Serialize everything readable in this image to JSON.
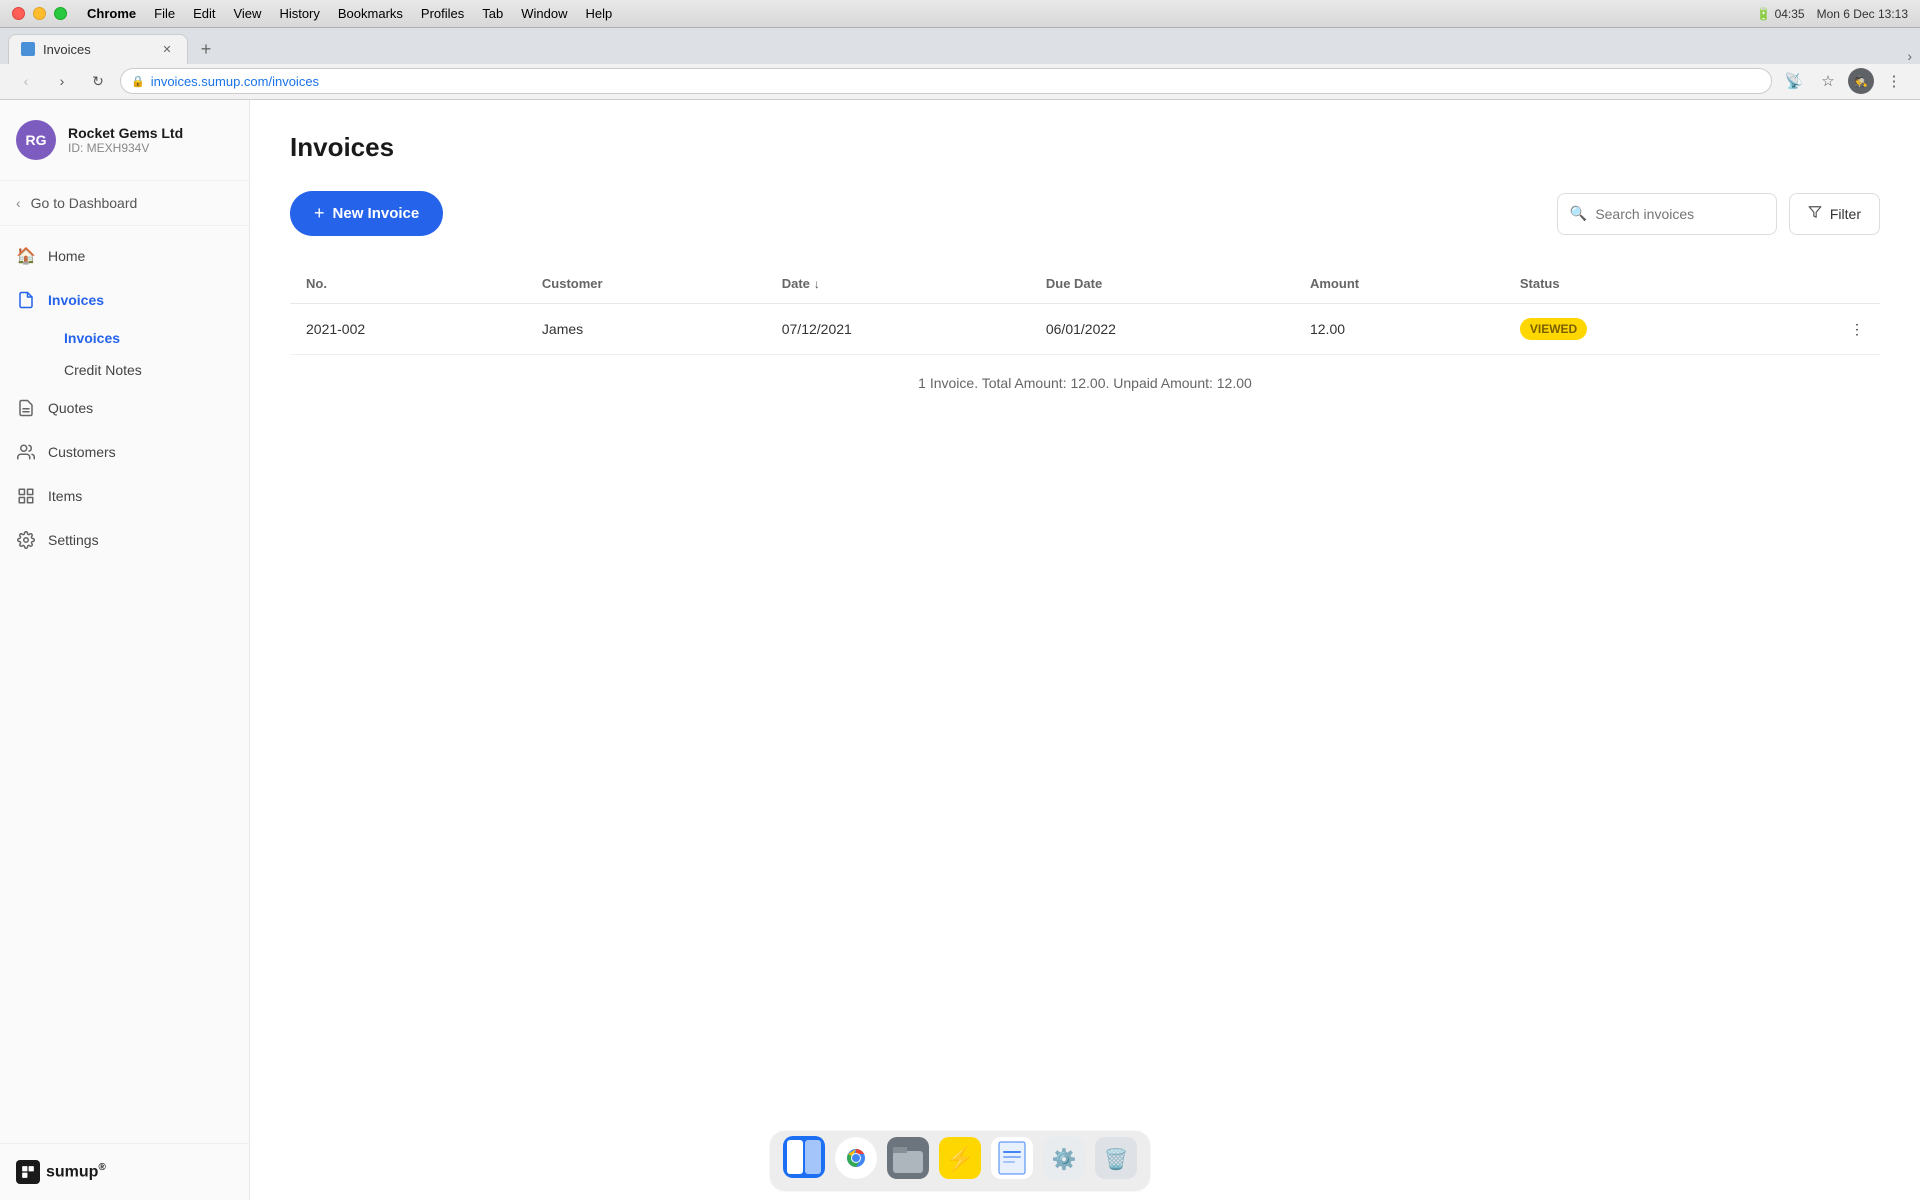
{
  "os": {
    "menu_items": [
      "Chrome",
      "File",
      "Edit",
      "View",
      "History",
      "Bookmarks",
      "Profiles",
      "Tab",
      "Window",
      "Help"
    ],
    "time": "Mon 6 Dec  13:13",
    "battery_time": "04:35"
  },
  "browser": {
    "tab_title": "Invoices",
    "tab_favicon_label": "I",
    "url": "invoices.sumup.com/invoices",
    "profile_label": "Incognito"
  },
  "sidebar": {
    "profile": {
      "initials": "RG",
      "name": "Rocket Gems Ltd",
      "id": "ID: MEXH934V"
    },
    "go_dashboard": "Go to Dashboard",
    "nav_items": [
      {
        "id": "home",
        "label": "Home",
        "icon": "🏠"
      },
      {
        "id": "invoices",
        "label": "Invoices",
        "icon": "📄",
        "active": true,
        "has_sub": true
      },
      {
        "id": "quotes",
        "label": "Quotes",
        "icon": "📋"
      },
      {
        "id": "customers",
        "label": "Customers",
        "icon": "👥"
      },
      {
        "id": "items",
        "label": "Items",
        "icon": "⊞"
      },
      {
        "id": "settings",
        "label": "Settings",
        "icon": "⚙️"
      }
    ],
    "sub_items": [
      {
        "id": "invoices-sub",
        "label": "Invoices",
        "active": true
      },
      {
        "id": "credit-notes",
        "label": "Credit Notes",
        "active": false
      }
    ],
    "logo": "sumup"
  },
  "main": {
    "page_title": "Invoices",
    "new_invoice_btn": "New Invoice",
    "search_placeholder": "Search invoices",
    "filter_btn": "Filter",
    "table": {
      "columns": [
        "No.",
        "Customer",
        "Date",
        "Due Date",
        "Amount",
        "Status"
      ],
      "rows": [
        {
          "number": "2021-002",
          "customer": "James",
          "date": "07/12/2021",
          "due_date": "06/01/2022",
          "amount": "12.00",
          "status": "VIEWED"
        }
      ],
      "summary": "1 Invoice. Total Amount: 12.00. Unpaid Amount: 12.00"
    }
  },
  "dock": {
    "items": [
      {
        "id": "finder",
        "emoji": "🔍",
        "label": "Finder"
      },
      {
        "id": "chrome",
        "emoji": "🌐",
        "label": "Chrome"
      },
      {
        "id": "notes",
        "emoji": "📁",
        "label": "Notes"
      },
      {
        "id": "bolt",
        "emoji": "⚡",
        "label": "Bolt"
      },
      {
        "id": "doc",
        "emoji": "📄",
        "label": "Doc"
      },
      {
        "id": "settings",
        "emoji": "⚙️",
        "label": "Settings"
      },
      {
        "id": "trash",
        "emoji": "🗑️",
        "label": "Trash"
      }
    ]
  }
}
